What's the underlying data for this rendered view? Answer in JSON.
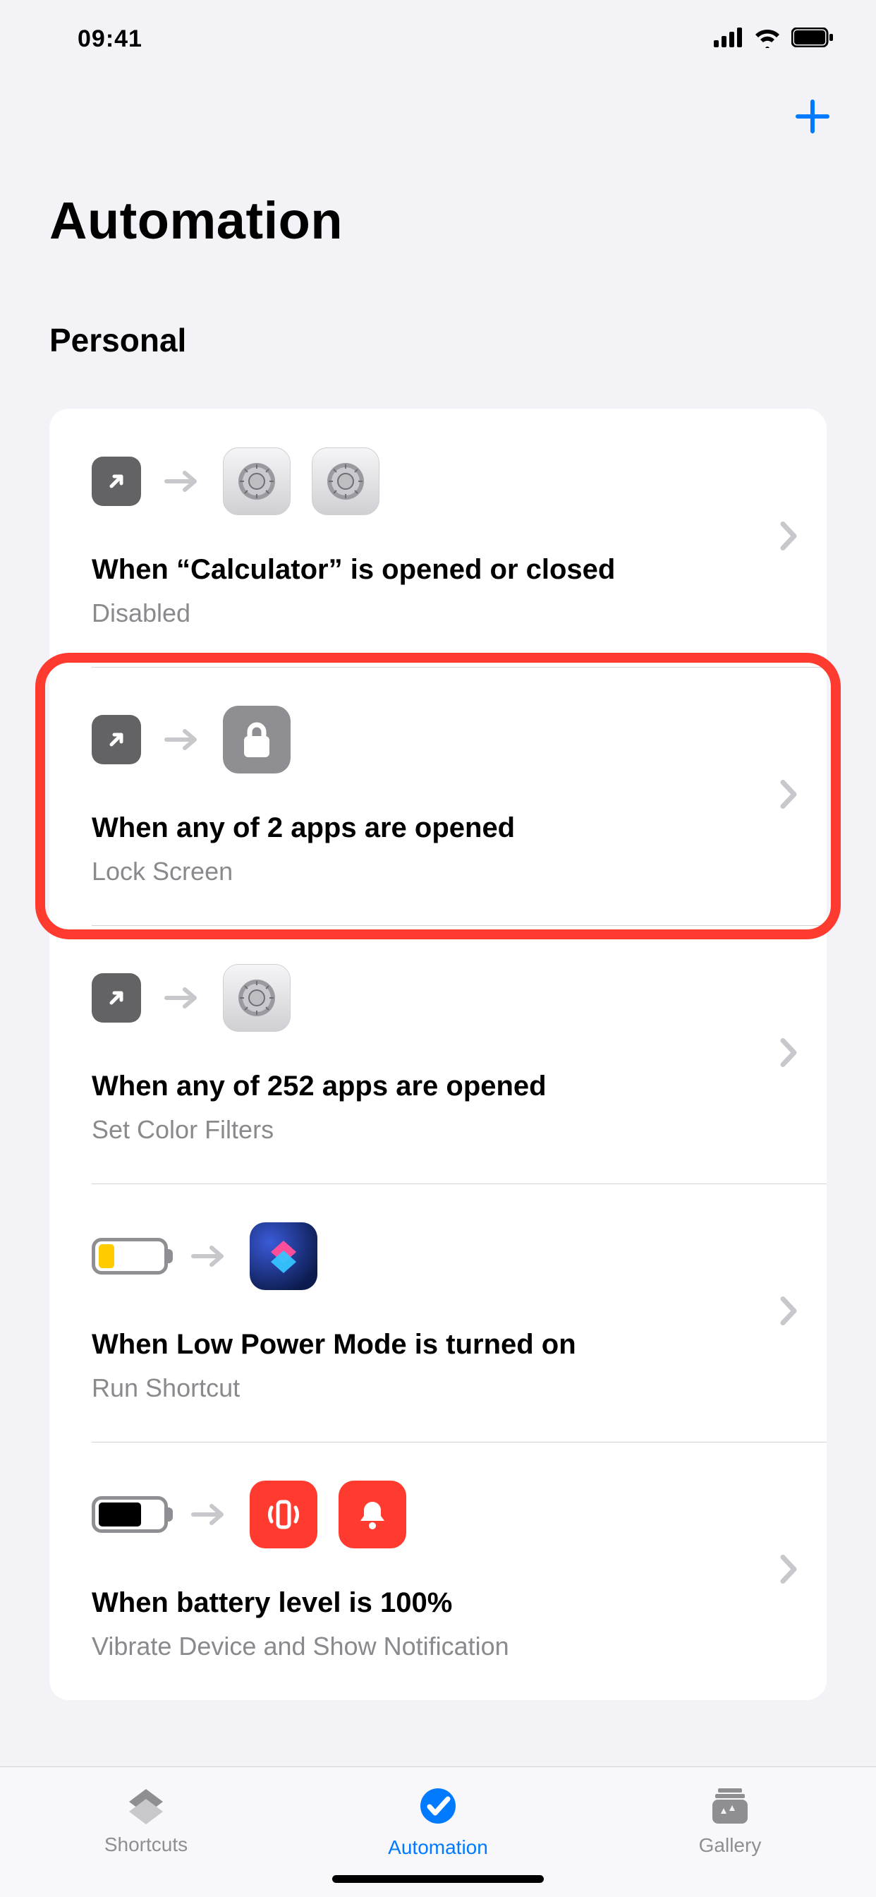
{
  "status": {
    "time": "09:41"
  },
  "nav": {
    "add_label": "Add"
  },
  "page_title": "Automation",
  "section_header": "Personal",
  "automations": [
    {
      "title": "When “Calculator” is opened or closed",
      "subtitle": "Disabled"
    },
    {
      "title": "When any of 2 apps are opened",
      "subtitle": "Lock Screen"
    },
    {
      "title": "When any of 252 apps are opened",
      "subtitle": "Set Color Filters"
    },
    {
      "title": "When Low Power Mode is turned on",
      "subtitle": "Run Shortcut"
    },
    {
      "title": "When battery level is 100%",
      "subtitle": "Vibrate Device and Show Notification"
    }
  ],
  "tabs": {
    "shortcuts": "Shortcuts",
    "automation": "Automation",
    "gallery": "Gallery"
  }
}
